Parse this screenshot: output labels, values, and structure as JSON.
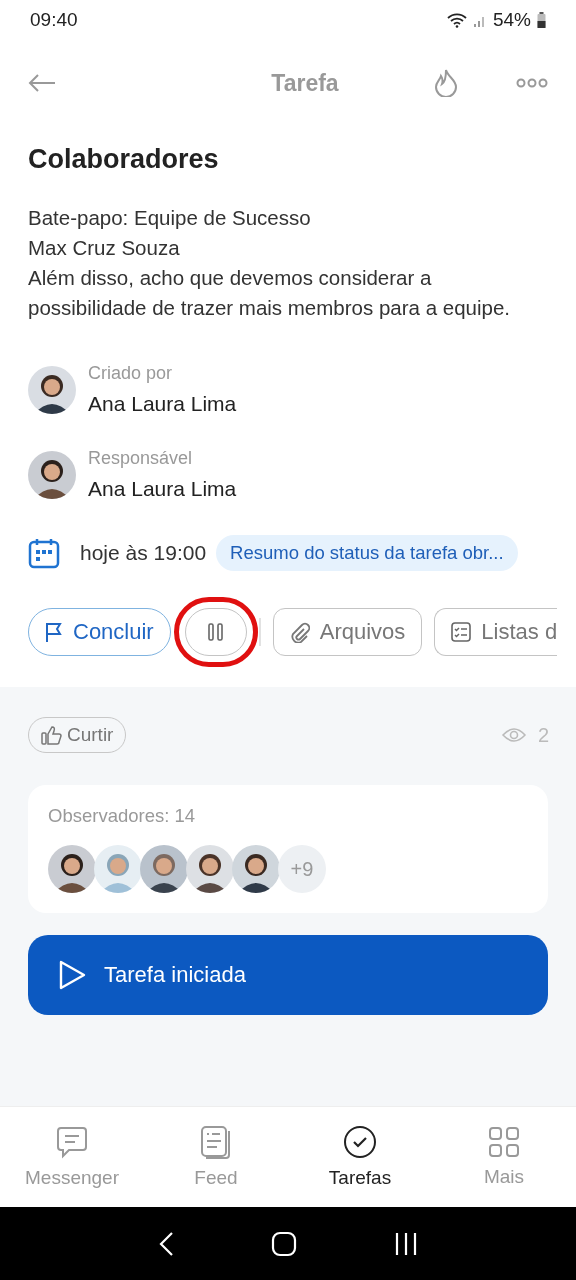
{
  "status_bar": {
    "time": "09:40",
    "battery": "54%"
  },
  "header": {
    "title": "Tarefa"
  },
  "section_title": "Colaboradores",
  "description": [
    "Bate-papo: Equipe de Sucesso",
    "Max Cruz Souza",
    "Além disso, acho que devemos considerar a possibilidade de trazer mais membros para a equipe."
  ],
  "people": [
    {
      "label": "Criado por",
      "name": "Ana Laura Lima"
    },
    {
      "label": "Responsável",
      "name": "Ana Laura Lima"
    }
  ],
  "deadline": {
    "text": "hoje às 19:00",
    "tag": "Resumo do status da tarefa obr..."
  },
  "actions": [
    {
      "kind": "complete",
      "label": "Concluir",
      "highlighted": false
    },
    {
      "kind": "pause",
      "highlighted": true
    },
    {
      "kind": "files",
      "label": "Arquivos",
      "highlighted": false
    },
    {
      "kind": "checklists",
      "label": "Listas d",
      "highlighted": false
    }
  ],
  "like": {
    "label": "Curtir"
  },
  "views": "2",
  "observers": {
    "label": "Observadores: 14",
    "more": "+9"
  },
  "start_button": {
    "label": "Tarefa iniciada"
  },
  "tabs": [
    {
      "kind": "messenger",
      "label": "Messenger",
      "selected": false
    },
    {
      "kind": "feed",
      "label": "Feed",
      "selected": false
    },
    {
      "kind": "tasks",
      "label": "Tarefas",
      "selected": true
    },
    {
      "kind": "more",
      "label": "Mais",
      "selected": false
    }
  ]
}
